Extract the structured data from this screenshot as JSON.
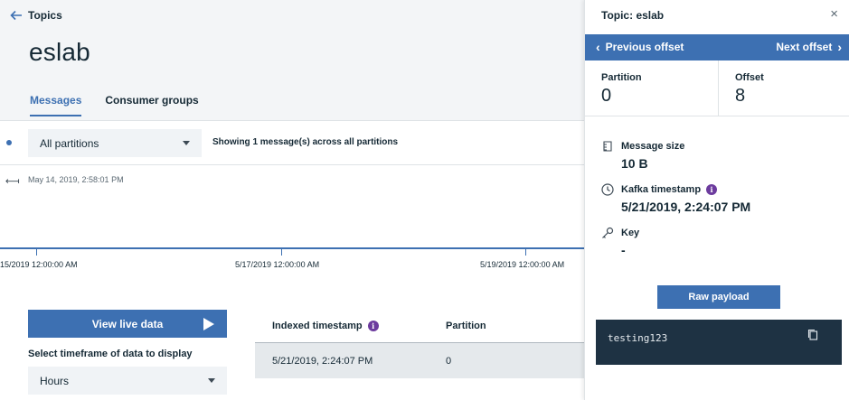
{
  "header": {
    "back_label": "Topics",
    "title": "eslab",
    "tabs": [
      {
        "label": "Messages",
        "active": true
      },
      {
        "label": "Consumer groups",
        "active": false
      }
    ]
  },
  "filters": {
    "partition_select": "All partitions",
    "showing_text": "Showing 1 message(s) across all partitions"
  },
  "timeline": {
    "start_date": "May 14, 2019, 2:58:01 PM",
    "ticks": [
      "15/2019 12:00:00 AM",
      "5/17/2019 12:00:00 AM",
      "5/19/2019 12:00:00 AM"
    ]
  },
  "controls": {
    "live_button": "View live data",
    "timeframe_label": "Select timeframe of data to display",
    "timeframe_value": "Hours"
  },
  "table": {
    "headers": {
      "timestamp": "Indexed timestamp",
      "partition": "Partition"
    },
    "rows": [
      {
        "timestamp": "5/21/2019, 2:24:07 PM",
        "partition": "0"
      }
    ]
  },
  "panel": {
    "title": "Topic: eslab",
    "close": "×",
    "prev_offset": "Previous offset",
    "next_offset": "Next offset",
    "partition_label": "Partition",
    "partition_value": "0",
    "offset_label": "Offset",
    "offset_value": "8",
    "message_size_label": "Message size",
    "message_size_value": "10 B",
    "kafka_ts_label": "Kafka timestamp",
    "kafka_ts_value": "5/21/2019, 2:24:07 PM",
    "key_label": "Key",
    "key_value": "-",
    "raw_payload_button": "Raw payload",
    "payload": "testing123"
  },
  "colors": {
    "accent": "#3d70b2",
    "info": "#6c3b9e",
    "code_bg": "#1e3243"
  }
}
